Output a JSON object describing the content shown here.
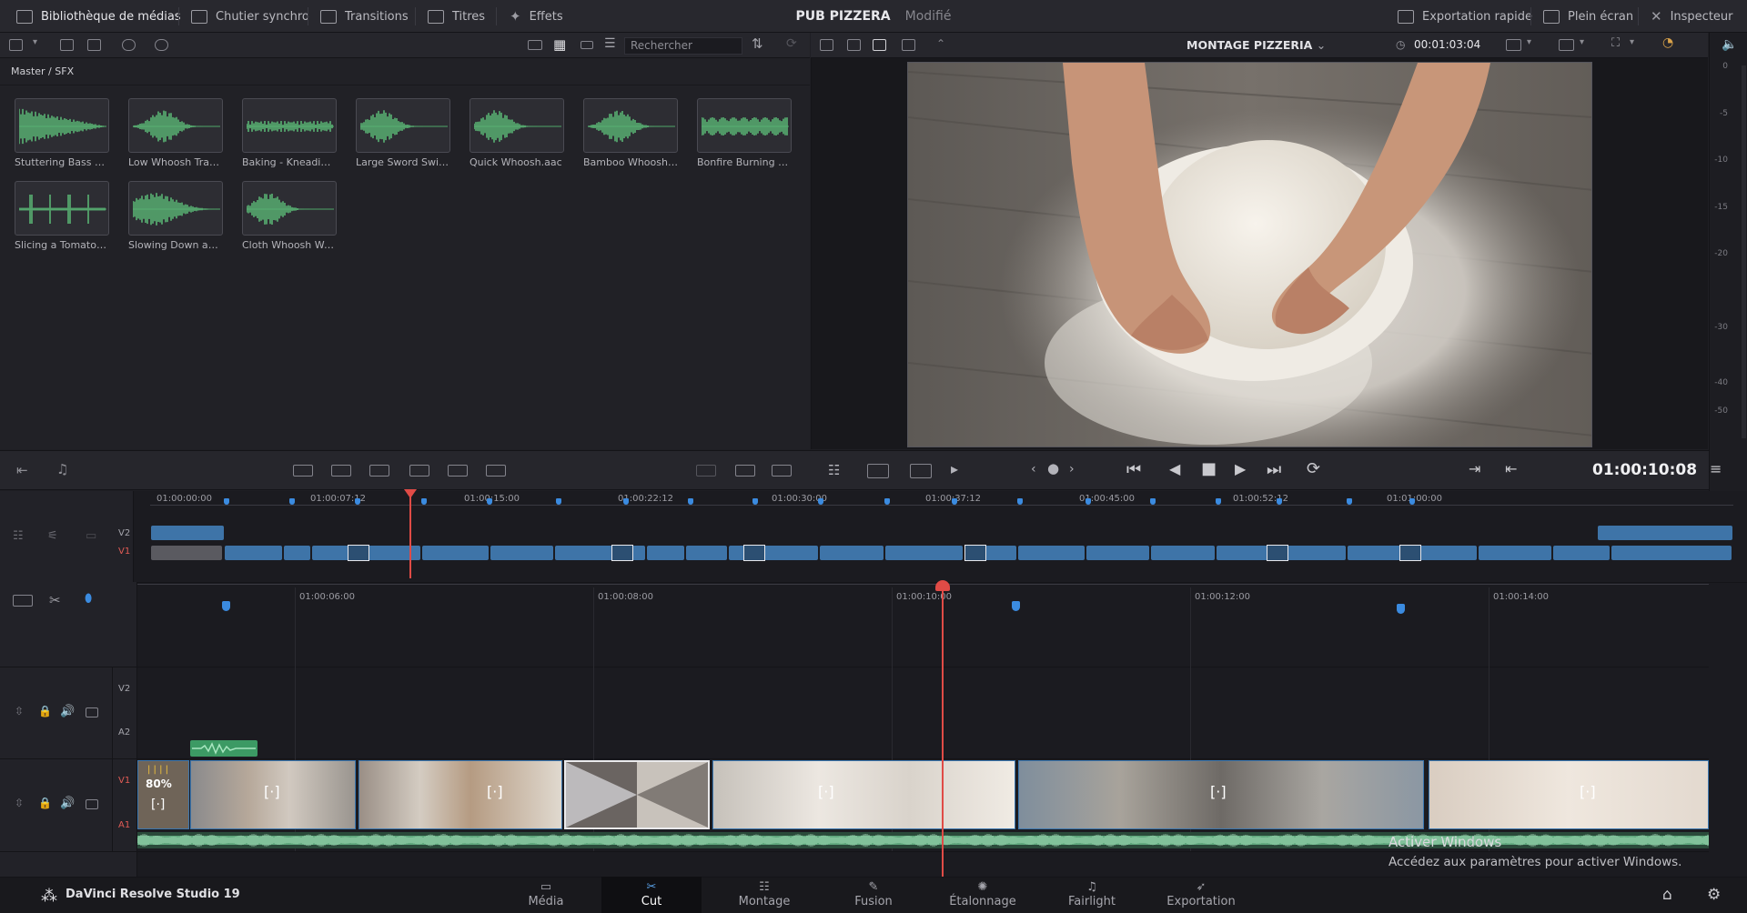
{
  "topbar": {
    "left_items": [
      "Bibliothèque de médias",
      "Chutier synchro",
      "Transitions",
      "Titres",
      "Effets"
    ],
    "project_name": "PUB PIZZERA",
    "project_status": "Modifié",
    "right_items": [
      "Exportation rapide",
      "Plein écran",
      "Inspecteur"
    ]
  },
  "media": {
    "search_placeholder": "Rechercher",
    "breadcrumb": "Master / SFX",
    "clips": [
      {
        "name": "Stuttering Bass Dr..."
      },
      {
        "name": "Low Whoosh Tran..."
      },
      {
        "name": "Baking - Kneading..."
      },
      {
        "name": "Large Sword Swip..."
      },
      {
        "name": "Quick Whoosh.aac"
      },
      {
        "name": "Bamboo Whoosh ..."
      },
      {
        "name": "Bonfire Burning P..."
      },
      {
        "name": "Slicing a Tomato 3..."
      },
      {
        "name": "Slowing Down an..."
      },
      {
        "name": "Cloth Whoosh Wa..."
      }
    ]
  },
  "viewer": {
    "timeline_name": "MONTAGE PIZZERIA",
    "duration": "00:01:03:04",
    "current_timecode": "01:00:10:08",
    "meter_scale": [
      "0",
      "-5",
      "-10",
      "-15",
      "-20",
      "-30",
      "-40",
      "-50"
    ]
  },
  "mini_timeline": {
    "ticks": [
      "01:00:00:00",
      "01:00:07:12",
      "01:00:15:00",
      "01:00:22:12",
      "01:00:30:00",
      "01:00:37:12",
      "01:00:45:00",
      "01:00:52:12",
      "01:01:00:00"
    ],
    "tracks": [
      "V2",
      "V1"
    ]
  },
  "timeline": {
    "ticks": [
      "01:00:06:00",
      "01:00:08:00",
      "01:00:10:00",
      "01:00:12:00",
      "01:00:14:00"
    ],
    "tracks": [
      "V2",
      "A2",
      "V1",
      "A1"
    ],
    "speed_badge": "80%"
  },
  "watermark": {
    "title": "Activer Windows",
    "subtitle": "Accédez aux paramètres pour activer Windows."
  },
  "bottombar": {
    "app_name": "DaVinci Resolve Studio 19",
    "pages": [
      "Média",
      "Cut",
      "Montage",
      "Fusion",
      "Étalonnage",
      "Fairlight",
      "Exportation"
    ],
    "active_page": "Cut"
  }
}
